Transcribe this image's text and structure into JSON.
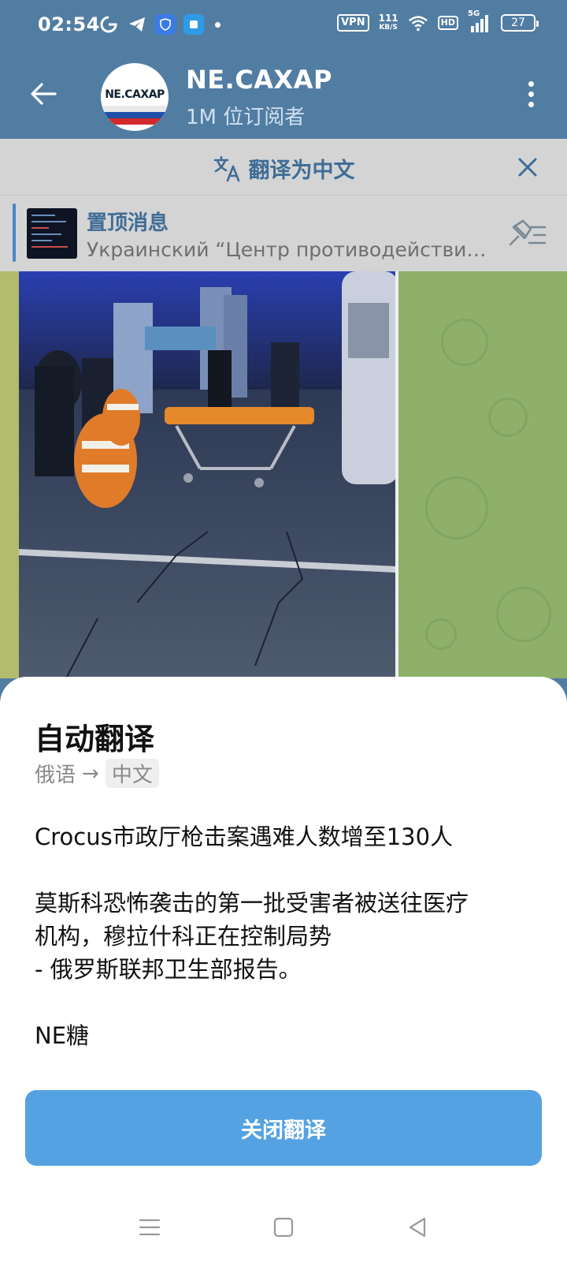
{
  "status_bar": {
    "time": "02:54",
    "vpn": "VPN",
    "net_speed_value": "111",
    "net_speed_unit": "KB/S",
    "hd": "HD",
    "signal": "5G",
    "battery": "27"
  },
  "header": {
    "avatar_text": "NE.CAXAP",
    "channel_name": "NE.CAXAP",
    "subscribers": "1M 位订阅者"
  },
  "translate_bar": {
    "label": "翻译为中文"
  },
  "pinned": {
    "title": "置顶消息",
    "preview": "Украинский “Центр противодействия дезинформации”"
  },
  "sheet": {
    "title": "自动翻译",
    "source_lang": "俄语",
    "arrow": "→",
    "target_lang": "中文",
    "paragraph1": "Crocus市政厅枪击案遇难人数增至130人",
    "paragraph2_line1": "莫斯科恐怖袭击的第一批受害者被送往医疗",
    "paragraph2_line2": "机构，穆拉什科正在控制局势",
    "paragraph2_line3": "- 俄罗斯联邦卫生部报告。",
    "paragraph3": "NE糖",
    "close_button": "关闭翻译"
  },
  "colors": {
    "header_bg": "#527da3",
    "accent_blue": "#55a2e3",
    "link_blue": "#3f6d96",
    "chat_bg": "#8eb06b"
  },
  "icons": {
    "back": "arrow-left-icon",
    "more": "more-vertical-icon",
    "translate": "translate-icon",
    "close": "close-icon",
    "pin_list": "pin-list-icon"
  }
}
